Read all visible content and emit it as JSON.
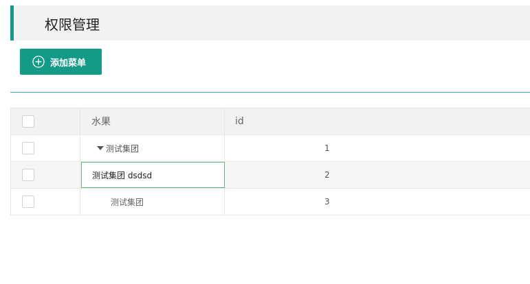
{
  "header": {
    "title": "权限管理"
  },
  "toolbar": {
    "add_label": "添加菜单",
    "add_icon": "plus-circle-icon"
  },
  "table": {
    "columns": [
      "水果",
      "id"
    ],
    "rows": [
      {
        "name": "测试集团",
        "id": "1",
        "expanded": true
      },
      {
        "name": "测试集团 dsdsd",
        "id": "2",
        "editing": true
      },
      {
        "name": "测试集团",
        "id": "3"
      }
    ]
  },
  "colors": {
    "accent": "#159a88",
    "divider": "#3aa2b2",
    "edit_border": "#5fb878"
  }
}
